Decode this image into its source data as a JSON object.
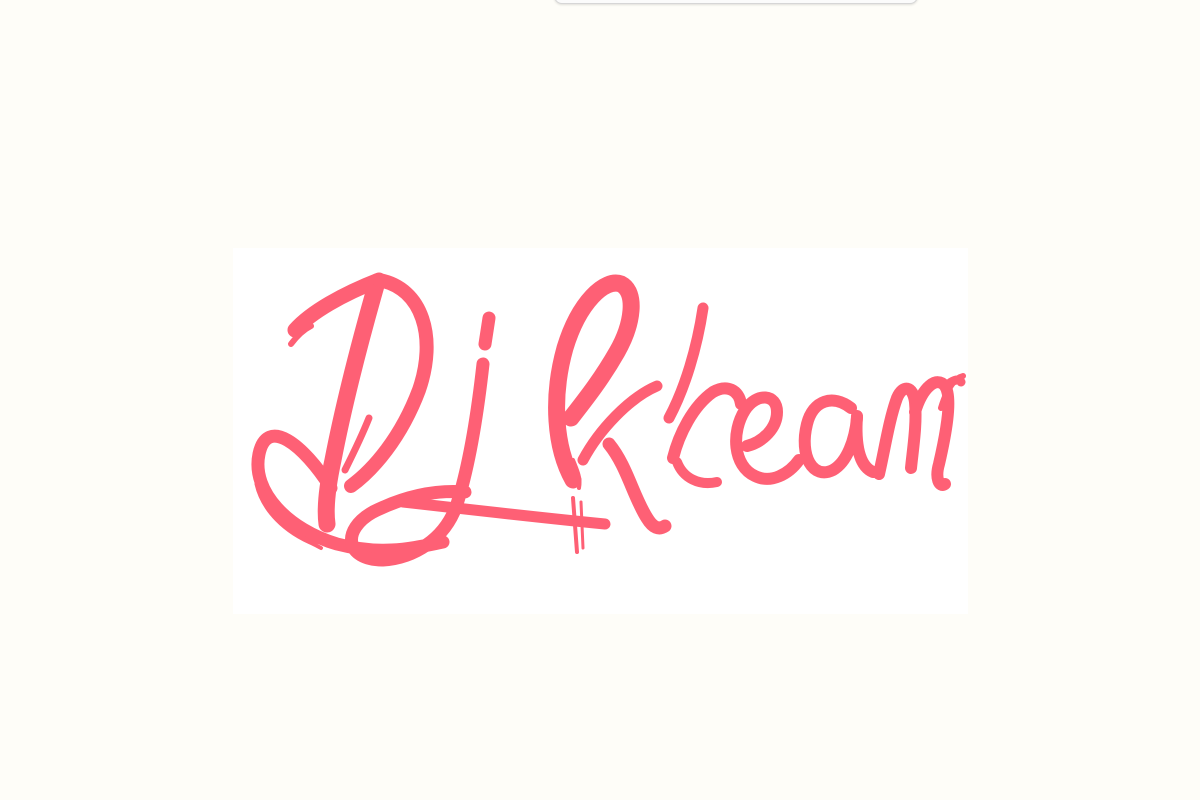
{
  "logo": {
    "text": "Dj Kream",
    "color": "#fe6075",
    "background": "#ffffff"
  },
  "page": {
    "background": "#fefdf8"
  }
}
